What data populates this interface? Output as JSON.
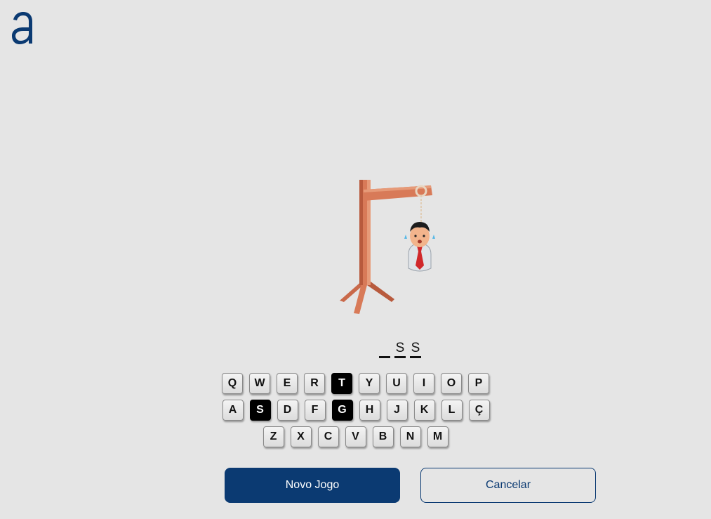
{
  "app": {
    "logo_icon": "brand-a-logo-icon",
    "brand_color": "#0b3a72"
  },
  "game": {
    "figure_icon": "hanging-man-gallows-icon",
    "word_slots": [
      "",
      "S",
      "S"
    ],
    "keyboard": {
      "rows": [
        [
          "Q",
          "W",
          "E",
          "R",
          "T",
          "Y",
          "U",
          "I",
          "O",
          "P"
        ],
        [
          "A",
          "S",
          "D",
          "F",
          "G",
          "H",
          "J",
          "K",
          "L",
          "Ç"
        ],
        [
          "Z",
          "X",
          "C",
          "V",
          "B",
          "N",
          "M"
        ]
      ],
      "used_letters": [
        "T",
        "S",
        "G"
      ]
    }
  },
  "actions": {
    "new_game_label": "Novo Jogo",
    "cancel_label": "Cancelar"
  }
}
